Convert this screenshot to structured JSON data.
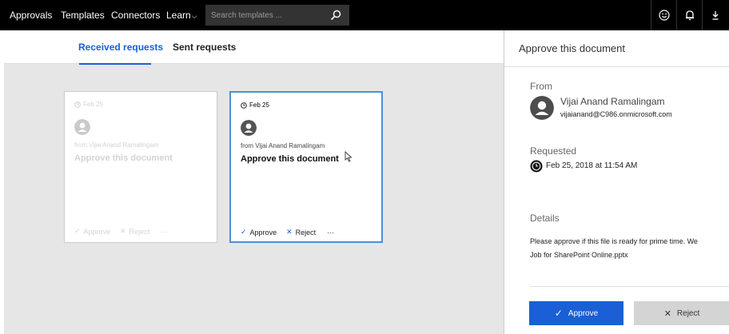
{
  "nav": {
    "items": [
      "Approvals",
      "Templates",
      "Connectors",
      "Learn"
    ],
    "learn_chevron": "⌵",
    "search_placeholder": "Search templates ...",
    "icons": [
      "search-icon",
      "smiley-icon",
      "bell-icon",
      "download-icon"
    ]
  },
  "tabs": {
    "received": "Received requests",
    "sent": "Sent requests"
  },
  "cards": [
    {
      "date": "Feb 25",
      "from": "from Vijai Anand Ramalingam",
      "title": "Approve this document",
      "approve": "Approve",
      "reject": "Reject",
      "more": "···",
      "state": "faded"
    },
    {
      "date": "Feb 25",
      "from": "from Vijai Anand Ramalingam",
      "title": "Approve this document",
      "approve": "Approve",
      "reject": "Reject",
      "more": "···",
      "state": "selected"
    }
  ],
  "detail": {
    "title": "Approve this document",
    "from_label": "From",
    "from_name": "Vijai Anand Ramalingam",
    "from_email": "vijaianand@C986.onmicrosoft.com",
    "requested_label": "Requested",
    "requested_date": "Feb 25, 2018 at 11:54 AM",
    "details_label": "Details",
    "details_line1": "Please approve if this file is ready for prime time. We",
    "details_line2": "Job for SharePoint Online.pptx",
    "approve_label": "Approve",
    "reject_label": "Reject"
  },
  "colors": {
    "accent": "#1a5fd6",
    "topbar": "#000000",
    "canvas": "#e6e6e6",
    "selected_border": "#4f8ed7"
  }
}
